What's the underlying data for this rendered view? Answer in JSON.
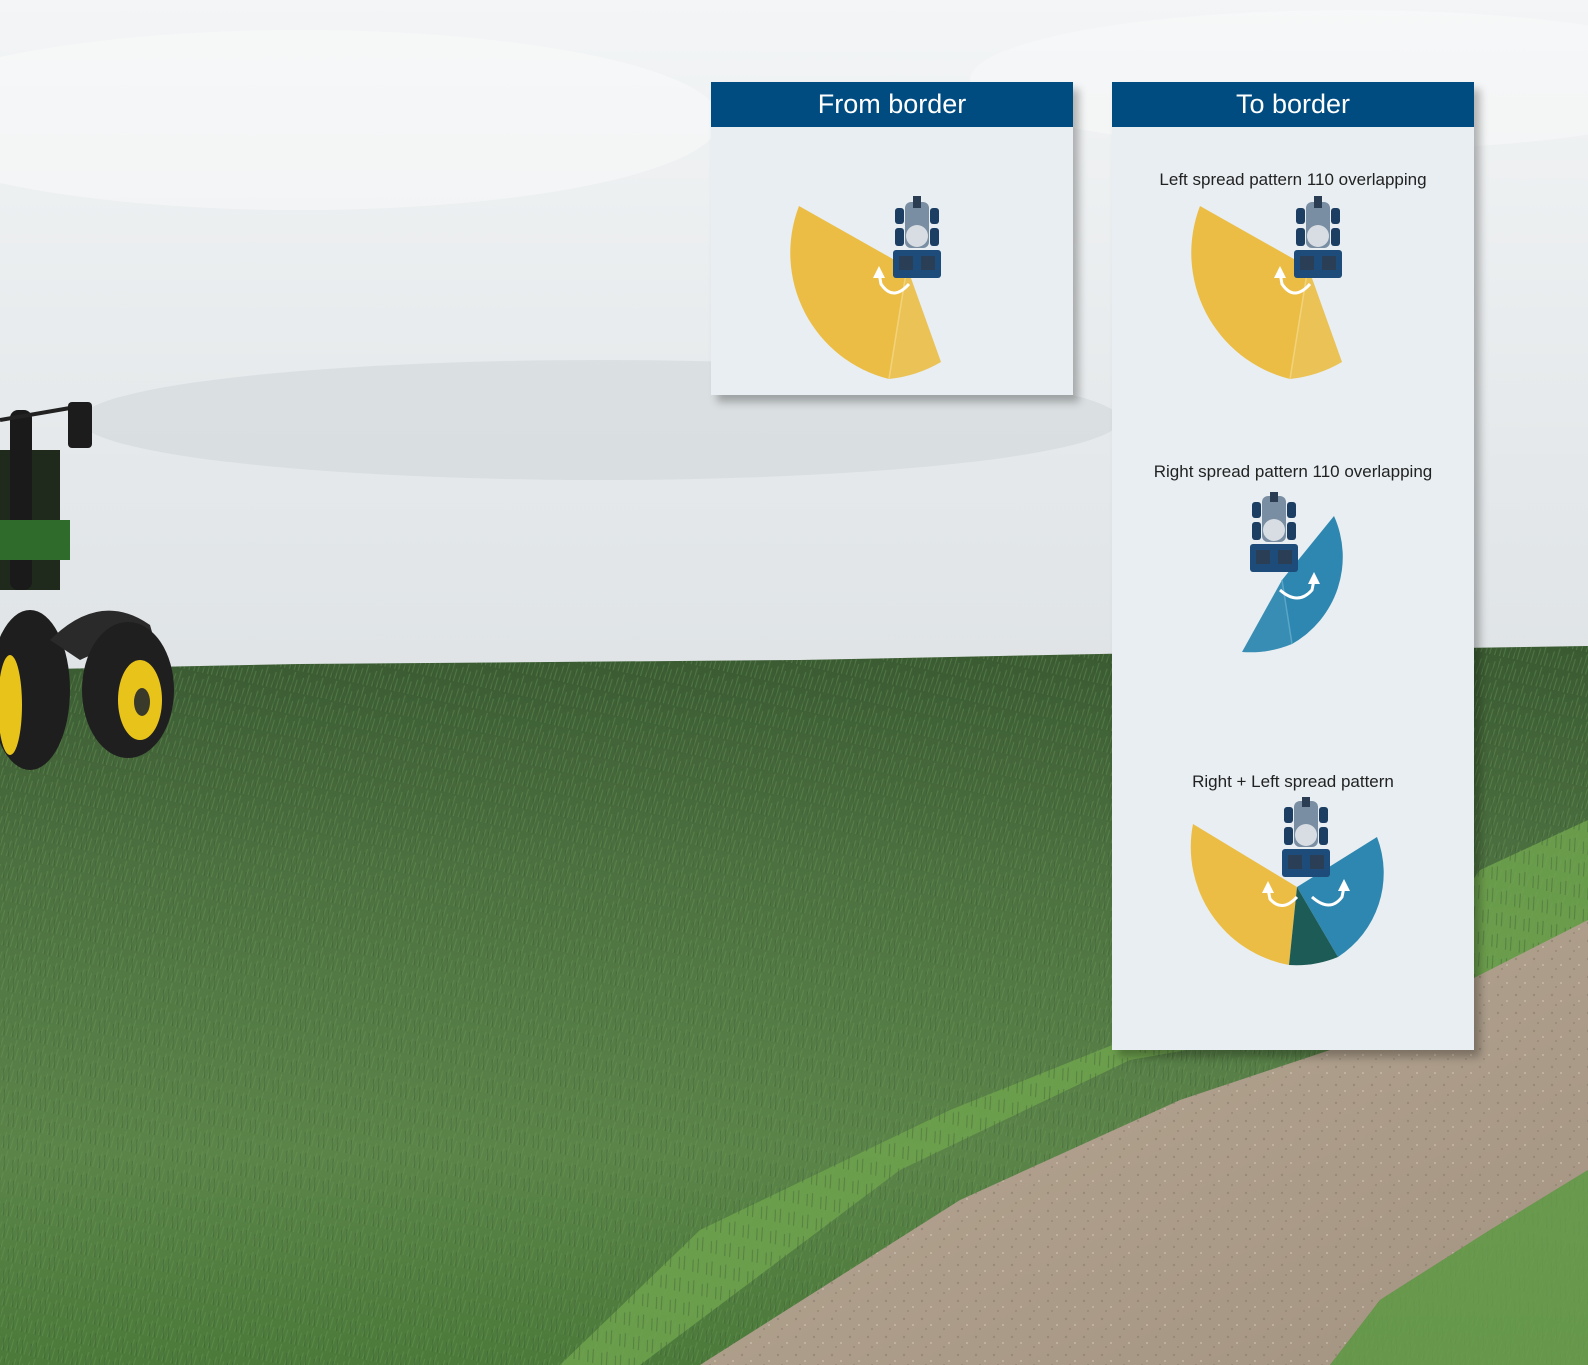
{
  "panels": {
    "from_border": {
      "title": "From border",
      "patterns": [
        {
          "label": "",
          "side": "left"
        }
      ]
    },
    "to_border": {
      "title": "To border",
      "patterns": [
        {
          "label": "Left spread pattern 110  overlapping",
          "side": "left"
        },
        {
          "label": "Right spread pattern 110  overlapping",
          "side": "right"
        },
        {
          "label": "Right + Left spread pattern",
          "side": "both"
        }
      ]
    }
  },
  "colors": {
    "header": "#004c80",
    "panel": "#e8eef1",
    "left_pattern": "#ebbd45",
    "right_pattern": "#2e87b0",
    "overlap": "#1d5b57"
  },
  "icons": {
    "tractor": "tractor-spreader-icon",
    "rotation": "curved-arrow-icon"
  }
}
